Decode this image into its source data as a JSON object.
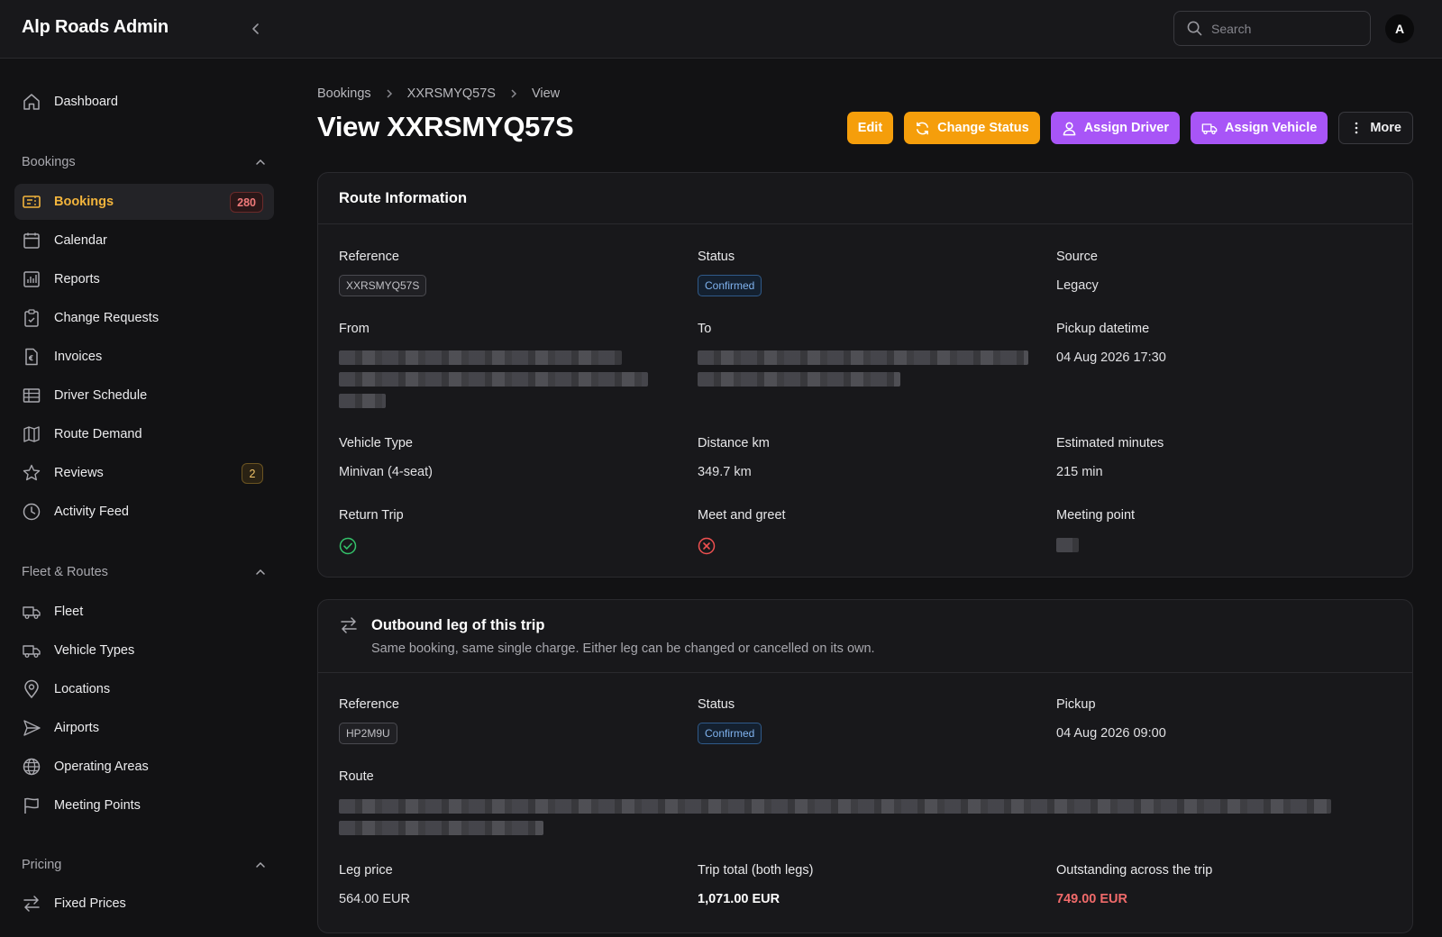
{
  "app": {
    "title": "Alp Roads Admin"
  },
  "header": {
    "search_placeholder": "Search",
    "avatar_initial": "A"
  },
  "sidebar": {
    "dashboard": "Dashboard",
    "groups": {
      "bookings": "Bookings",
      "fleet": "Fleet & Routes",
      "pricing": "Pricing"
    },
    "items": {
      "bookings": {
        "label": "Bookings",
        "badge": "280"
      },
      "calendar": "Calendar",
      "reports": "Reports",
      "change_requests": "Change Requests",
      "invoices": "Invoices",
      "driver_schedule": "Driver Schedule",
      "route_demand": "Route Demand",
      "reviews": {
        "label": "Reviews",
        "badge": "2"
      },
      "activity_feed": "Activity Feed",
      "fleet": "Fleet",
      "vehicle_types": "Vehicle Types",
      "locations": "Locations",
      "airports": "Airports",
      "operating_areas": "Operating Areas",
      "meeting_points": "Meeting Points",
      "fixed_prices": "Fixed Prices"
    }
  },
  "breadcrumb": [
    "Bookings",
    "XXRSMYQ57S",
    "View"
  ],
  "page": {
    "title": "View XXRSMYQ57S",
    "actions": {
      "edit": "Edit",
      "change_status": "Change Status",
      "assign_driver": "Assign Driver",
      "assign_vehicle": "Assign Vehicle",
      "more": "More"
    }
  },
  "route_info": {
    "title": "Route Information",
    "reference_label": "Reference",
    "reference": "XXRSMYQ57S",
    "status_label": "Status",
    "status": "Confirmed",
    "source_label": "Source",
    "source": "Legacy",
    "from_label": "From",
    "to_label": "To",
    "pickup_label": "Pickup datetime",
    "pickup": "04 Aug 2026 17:30",
    "vehicle_type_label": "Vehicle Type",
    "vehicle_type": "Minivan (4-seat)",
    "distance_label": "Distance km",
    "distance": "349.7 km",
    "minutes_label": "Estimated minutes",
    "minutes": "215 min",
    "return_trip_label": "Return Trip",
    "meet_greet_label": "Meet and greet",
    "meeting_point_label": "Meeting point"
  },
  "outbound": {
    "title": "Outbound leg of this trip",
    "subtitle": "Same booking, same single charge. Either leg can be changed or cancelled on its own.",
    "reference_label": "Reference",
    "reference": "HP2M9U",
    "status_label": "Status",
    "status": "Confirmed",
    "pickup_label": "Pickup",
    "pickup": "04 Aug 2026 09:00",
    "route_label": "Route",
    "leg_price_label": "Leg price",
    "leg_price": "564.00 EUR",
    "trip_total_label": "Trip total (both legs)",
    "trip_total": "1,071.00 EUR",
    "outstanding_label": "Outstanding across the trip",
    "outstanding": "749.00 EUR"
  },
  "colors": {
    "accent": "#f59e0b",
    "purple": "#a855f7",
    "success": "#22c55e",
    "danger": "#ef4444"
  }
}
